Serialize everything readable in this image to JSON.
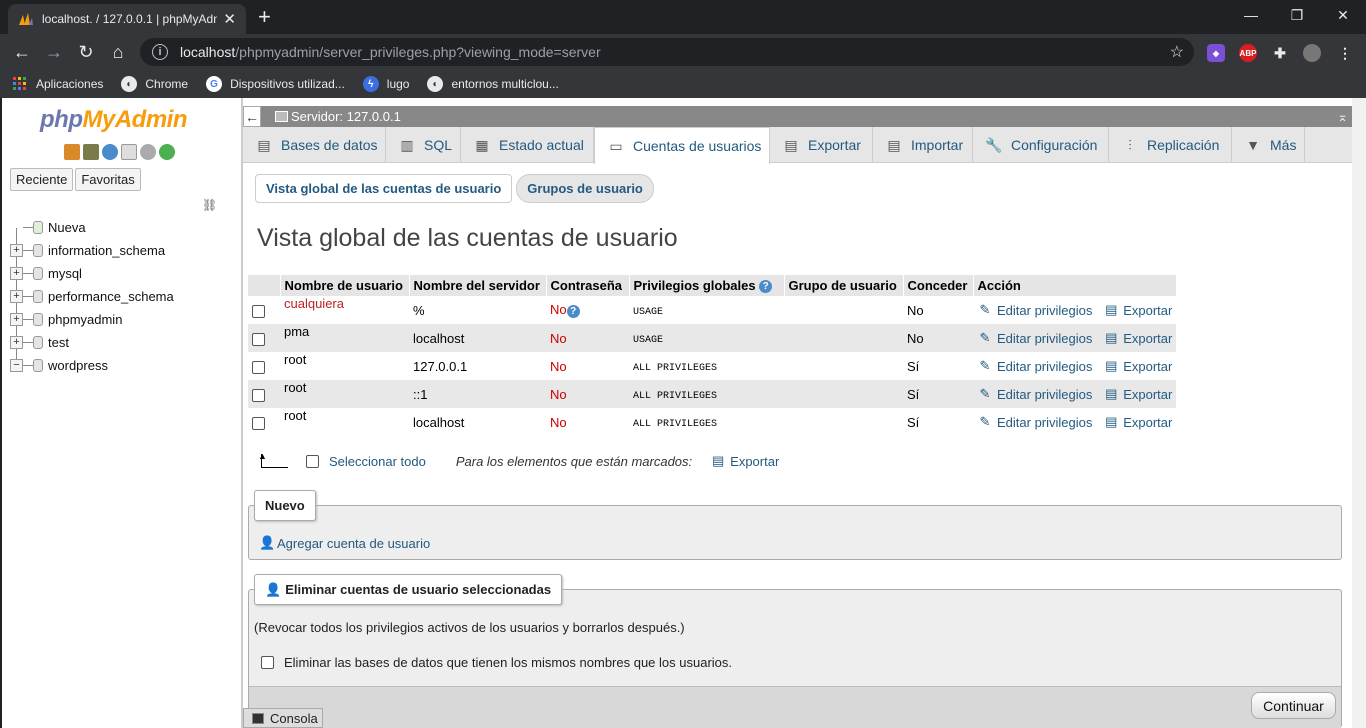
{
  "browser": {
    "tab_title": "localhost. / 127.0.0.1 | phpMyAdn",
    "url_host": "localhost",
    "url_path": "/phpmyadmin/server_privileges.php?viewing_mode=server",
    "bookmarks": [
      {
        "label": "Aplicaciones",
        "icon": "apps-grid-icon"
      },
      {
        "label": "Chrome",
        "icon": "globe-icon"
      },
      {
        "label": "Dispositivos utilizad...",
        "icon": "google-icon"
      },
      {
        "label": "lugo",
        "icon": "bolt-icon"
      },
      {
        "label": "entornos multiclou...",
        "icon": "globe-icon"
      }
    ]
  },
  "sidebar": {
    "logo_php": "php",
    "logo_myadmin": "MyAdmin",
    "tabs": [
      "Reciente",
      "Favoritas"
    ],
    "tree": [
      "Nueva",
      "information_schema",
      "mysql",
      "performance_schema",
      "phpmyadmin",
      "test",
      "wordpress"
    ]
  },
  "breadcrumb": {
    "server": "Servidor: 127.0.0.1"
  },
  "menu": {
    "tabs": [
      "Bases de datos",
      "SQL",
      "Estado actual",
      "Cuentas de usuarios",
      "Exportar",
      "Importar",
      "Configuración",
      "Replicación",
      "Más"
    ]
  },
  "subtabs": [
    "Vista global de las cuentas de usuario",
    "Grupos de usuario"
  ],
  "page_title": "Vista global de las cuentas de usuario",
  "users_table": {
    "headers": [
      "Nombre de usuario",
      "Nombre del servidor",
      "Contraseña",
      "Privilegios globales",
      "Grupo de usuario",
      "Conceder",
      "Acción"
    ],
    "rows": [
      {
        "user": "cualquiera",
        "host": "%",
        "password": "No",
        "privileges": "USAGE",
        "group": "",
        "grant": "No"
      },
      {
        "user": "pma",
        "host": "localhost",
        "password": "No",
        "privileges": "USAGE",
        "group": "",
        "grant": "No"
      },
      {
        "user": "root",
        "host": "127.0.0.1",
        "password": "No",
        "privileges": "ALL PRIVILEGES",
        "group": "",
        "grant": "Sí"
      },
      {
        "user": "root",
        "host": "::1",
        "password": "No",
        "privileges": "ALL PRIVILEGES",
        "group": "",
        "grant": "Sí"
      },
      {
        "user": "root",
        "host": "localhost",
        "password": "No",
        "privileges": "ALL PRIVILEGES",
        "group": "",
        "grant": "Sí"
      }
    ],
    "edit_label": "Editar privilegios",
    "export_label": "Exportar"
  },
  "selection": {
    "select_all": "Seleccionar todo",
    "with_selected": "Para los elementos que están marcados:",
    "export": "Exportar"
  },
  "new_section": {
    "legend": "Nuevo",
    "add_user": "Agregar cuenta de usuario"
  },
  "delete_section": {
    "legend": "Eliminar cuentas de usuario seleccionadas",
    "description": "(Revocar todos los privilegios activos de los usuarios y borrarlos después.)",
    "drop_db_label": "Eliminar las bases de datos que tienen los mismos nombres que los usuarios.",
    "continue": "Continuar"
  },
  "console": {
    "label": "Consola"
  }
}
